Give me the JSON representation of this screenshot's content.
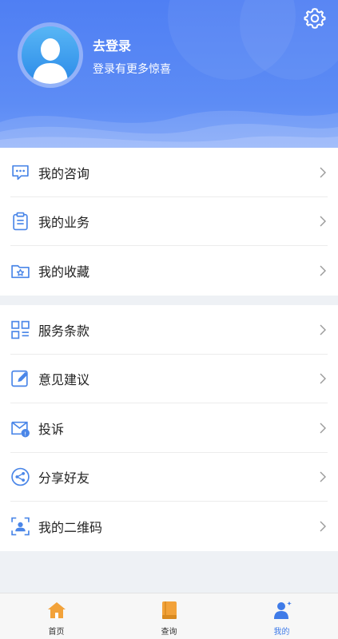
{
  "profile": {
    "login_title": "去登录",
    "login_subtitle": "登录有更多惊喜"
  },
  "menu_group_1": [
    {
      "label": "我的咨询",
      "icon": "chat-icon"
    },
    {
      "label": "我的业务",
      "icon": "clipboard-icon"
    },
    {
      "label": "我的收藏",
      "icon": "folder-star-icon"
    }
  ],
  "menu_group_2": [
    {
      "label": "服务条款",
      "icon": "grid-list-icon"
    },
    {
      "label": "意见建议",
      "icon": "edit-icon"
    },
    {
      "label": "投诉",
      "icon": "mail-complaint-icon"
    },
    {
      "label": "分享好友",
      "icon": "share-icon"
    },
    {
      "label": "我的二维码",
      "icon": "qrcode-icon"
    }
  ],
  "tabbar": [
    {
      "label": "首页",
      "icon": "home-icon",
      "active": false
    },
    {
      "label": "查询",
      "icon": "book-icon",
      "active": false
    },
    {
      "label": "我的",
      "icon": "user-icon",
      "active": true
    }
  ],
  "colors": {
    "header_blue": "#4f7ff3",
    "icon_blue": "#4a86e8",
    "tab_orange": "#f2a23a",
    "tab_active": "#3f7be8"
  }
}
